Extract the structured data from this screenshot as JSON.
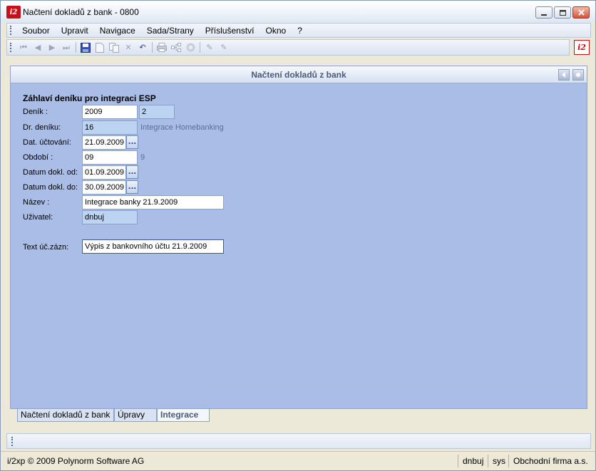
{
  "window": {
    "title": "Načtení dokladů z bank - 0800"
  },
  "menu": [
    "Soubor",
    "Upravit",
    "Navigace",
    "Sada/Strany",
    "Příslušenství",
    "Okno",
    "?"
  ],
  "toolbar_icons": [
    "first-record-icon",
    "prev-record-icon",
    "next-record-icon",
    "last-record-icon",
    "save-icon",
    "new-icon",
    "copy-icon",
    "delete-icon",
    "undo-icon",
    "print-icon",
    "tree-icon",
    "refresh-icon",
    "edit-icon",
    "edit-alt-icon"
  ],
  "panel": {
    "title": "Načtení dokladů z bank",
    "section_title": "Záhlaví deníku pro integraci ESP",
    "fields": {
      "denik_label": "Deník  :",
      "denik_value": "2009",
      "denik_extra": "2",
      "dr_deniku_label": "Dr. deníku:",
      "dr_deniku_value": "16",
      "dr_deniku_hint": "Integrace Homebanking",
      "dat_uctovani_label": "Dat. účtování:",
      "dat_uctovani_value": "21.09.2009",
      "obdobi_label": "Období :",
      "obdobi_value": "09",
      "obdobi_hint": "9",
      "datum_od_label": "Datum dokl. od:",
      "datum_od_value": "01.09.2009",
      "datum_do_label": "Datum dokl. do:",
      "datum_do_value": "30.09.2009",
      "nazev_label": "Název     :",
      "nazev_value": "Integrace banky 21.9.2009",
      "uzivatel_label": "Uživatel:",
      "uzivatel_value": "dnbuj",
      "text_label": "Text úč.zázn:",
      "text_value": "Výpis z bankovního účtu 21.9.2009"
    },
    "lookup_button": "..."
  },
  "tabs": [
    "Načtení dokladů z bank",
    "Úpravy",
    "Integrace"
  ],
  "active_tab": "Integrace",
  "status": {
    "copyright": "i/2xp © 2009 Polynorm Software AG",
    "user": "dnbuj",
    "system": "sys",
    "company": "Obchodní firma a.s."
  }
}
